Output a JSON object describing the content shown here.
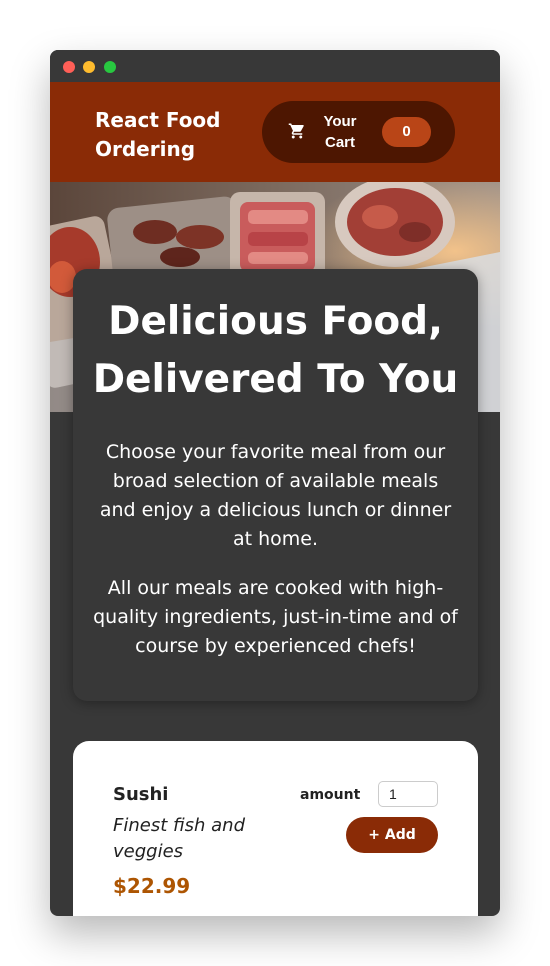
{
  "header": {
    "brand": "React Food Ordering",
    "cart_label": "Your Cart",
    "cart_count": "0",
    "cart_icon": "cart-icon"
  },
  "summary": {
    "title": "Delicious Food, Delivered To You",
    "paragraph1": "Choose your favorite meal from our broad selection of available meals and enjoy a delicious lunch or dinner at home.",
    "paragraph2": "All our meals are cooked with high-quality ingredients, just-in-time and of course by experienced chefs!"
  },
  "meals": [
    {
      "name": "Sushi",
      "description": "Finest fish and veggies",
      "price": "$22.99",
      "amount_label": "amount",
      "amount_value": "1",
      "add_label": "+ Add"
    }
  ],
  "colors": {
    "header": "#8a2b06",
    "cart_button": "#4d1601",
    "badge": "#b94517",
    "price": "#ad5502",
    "background": "#383838"
  }
}
